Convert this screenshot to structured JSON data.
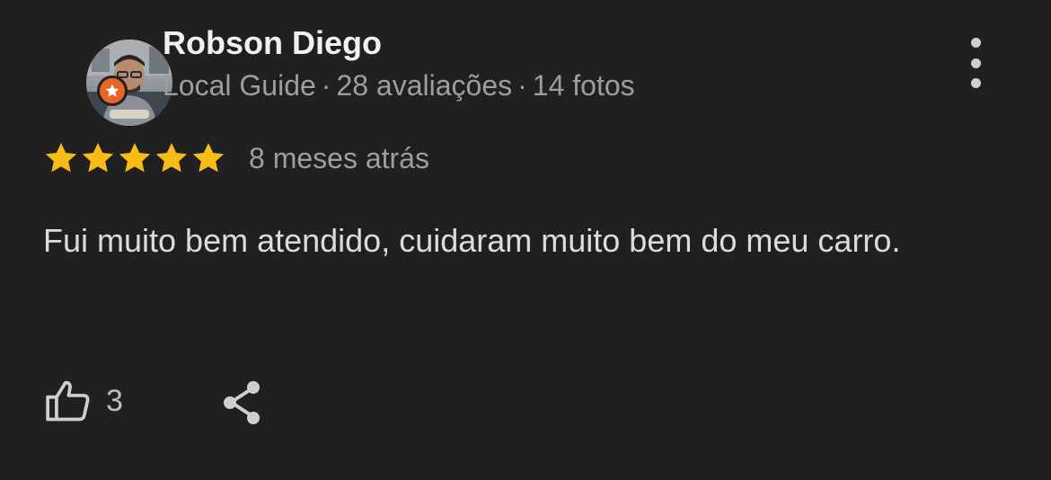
{
  "reviewer": {
    "name": "Robson Diego",
    "level": "Local Guide",
    "separator": "·",
    "reviews": "28 avaliações",
    "photos": "14 fotos",
    "badge_color": "#e8652a",
    "avatar_icon": "user-photo"
  },
  "rating": {
    "stars": 5,
    "max": 5,
    "star_color": "#f9bc15",
    "time_ago": "8 meses atrás"
  },
  "review": {
    "text": "Fui muito bem atendido, cuidaram muito bem do meu carro."
  },
  "actions": {
    "like_count": "3",
    "like_icon": "thumbs-up-icon",
    "share_icon": "share-icon",
    "more_icon": "more-vertical-icon"
  }
}
